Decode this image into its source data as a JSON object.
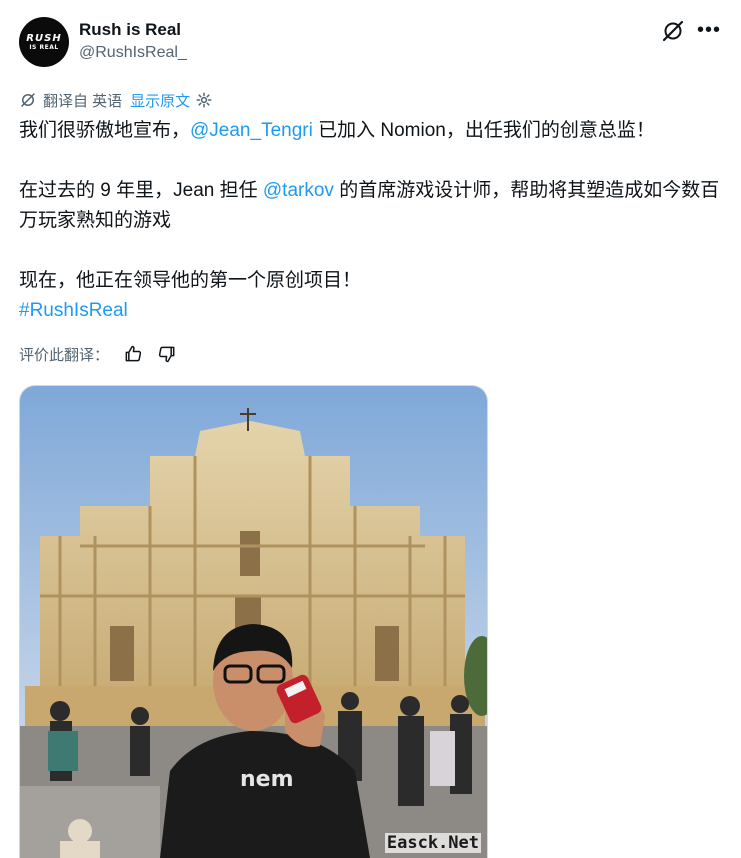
{
  "account": {
    "avatar_line1": "RUSH",
    "avatar_line2": "IS REAL",
    "name": "Rush is Real",
    "handle": "@RushIsReal_"
  },
  "header_icons": [
    "grok-icon",
    "more-icon"
  ],
  "more_glyph": "•••",
  "translation": {
    "label": "翻译自 英语",
    "show_original": "显示原文"
  },
  "tweet": {
    "p1_before": "我们很骄傲地宣布，",
    "p1_mention": "@Jean_Tengri",
    "p1_after": " 已加入 Nomion，出任我们的创意总监！",
    "p2_before": "在过去的 9 年里，Jean 担任 ",
    "p2_mention": "@tarkov",
    "p2_after": " 的首席游戏设计师，帮助将其塑造成如今数百万玩家熟知的游戏",
    "p3": "现在，他正在领导他的第一个原创项目！",
    "hashtag": "#RushIsReal"
  },
  "rate": {
    "label": "评价此翻译："
  },
  "watermark": "Easck.Net",
  "colors": {
    "link": "#1d9bf0",
    "secondary_text": "#536471",
    "primary_text": "#0f1419"
  }
}
